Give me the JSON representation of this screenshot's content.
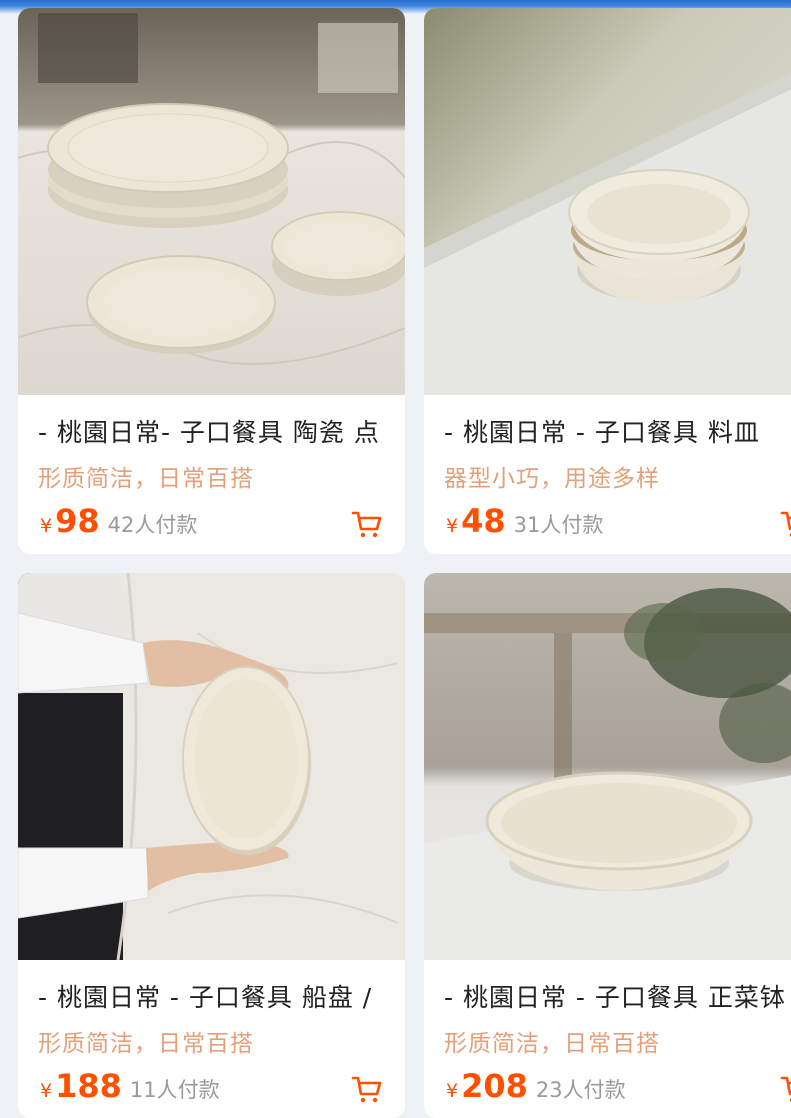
{
  "products": [
    {
      "title": "- 桃園日常- 子口餐具 陶瓷 点",
      "tagline": "形质简洁，日常百搭",
      "currency": "¥",
      "price": "98",
      "sold": "42人付款"
    },
    {
      "title": "- 桃園日常 - 子口餐具 料皿",
      "tagline": "器型小巧，用途多样",
      "currency": "¥",
      "price": "48",
      "sold": "31人付款"
    },
    {
      "title": "- 桃園日常 - 子口餐具 船盘 /",
      "tagline": "形质简洁，日常百搭",
      "currency": "¥",
      "price": "188",
      "sold": "11人付款"
    },
    {
      "title": "- 桃園日常 - 子口餐具 正菜钵",
      "tagline": "形质简洁，日常百搭",
      "currency": "¥",
      "price": "208",
      "sold": "23人付款"
    }
  ],
  "colors": {
    "price": "#ff5000",
    "tagline": "#e3a07a",
    "sold": "#9a9a9a"
  },
  "icons": {
    "cart": "shopping-cart-icon"
  }
}
